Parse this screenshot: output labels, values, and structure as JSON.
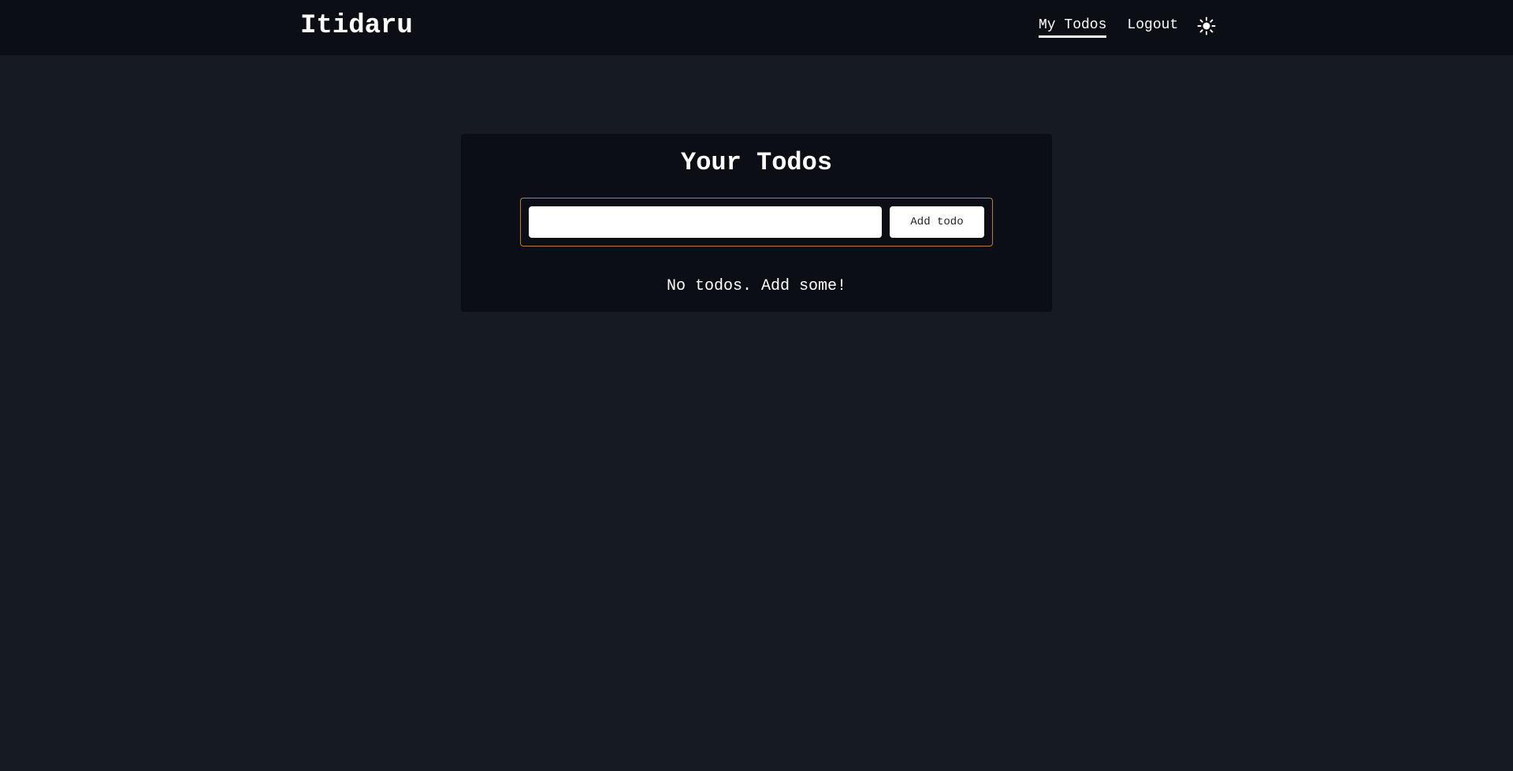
{
  "app": {
    "brand": "Itidaru"
  },
  "nav": {
    "items": [
      {
        "label": "My Todos",
        "active": true
      },
      {
        "label": "Logout",
        "active": false
      }
    ],
    "theme_toggle_icon": "sun-icon"
  },
  "main": {
    "title": "Your Todos",
    "form": {
      "input_value": "",
      "input_placeholder": "",
      "add_button_label": "Add todo"
    },
    "empty_message": "No todos. Add some!"
  },
  "colors": {
    "background": "#161a23",
    "surface": "#0b0e15",
    "form_border": "#c07a2e",
    "text": "#ffffff"
  }
}
